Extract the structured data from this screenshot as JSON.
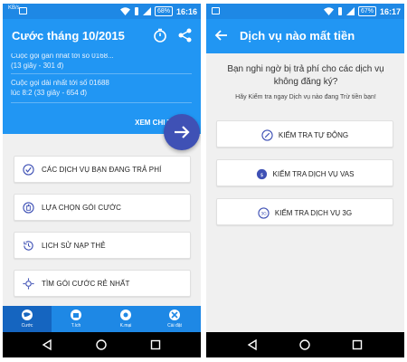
{
  "screen1": {
    "status": {
      "network": "KB/s",
      "battery": "68%",
      "time": "16:16"
    },
    "title": "Cước tháng 10/2015",
    "partial_line": "Cuộc gọi gần nhất tới số 0168...",
    "partial_line2": "(13 giây - 301 đ)",
    "longest_call_line1": "Cuộc gọi dài nhất tới số 01688",
    "longest_call_line2": "lúc 8:2 (33 giây - 654 đ)",
    "detail_link": "XEM CHI TIẾT",
    "menu": [
      {
        "label": "CÁC DỊCH VỤ BẠN ĐANG TRẢ PHÍ",
        "icon": "check-circle-icon"
      },
      {
        "label": "LỰA CHỌN GÓI CƯỚC",
        "icon": "hand-icon"
      },
      {
        "label": "LỊCH SỬ NẠP THẺ",
        "icon": "history-icon"
      },
      {
        "label": "TÌM GÓI CƯỚC RẺ NHẤT",
        "icon": "search-package-icon"
      }
    ],
    "tabs": [
      {
        "label": "Cước",
        "icon": "globe-icon",
        "active": true
      },
      {
        "label": "T.ích",
        "icon": "gift-icon",
        "active": false
      },
      {
        "label": "K.mại",
        "icon": "promo-icon",
        "active": false
      },
      {
        "label": "Cài đặt",
        "icon": "tools-icon",
        "active": false
      }
    ]
  },
  "screen2": {
    "status": {
      "battery": "67%",
      "time": "16:17"
    },
    "title": "Dịch vụ nào mất tiền",
    "question": "Bạn nghi ngờ bị trả phí cho các dịch vụ không đăng ký?",
    "hint": "Hãy Kiểm tra ngay Dịch vụ nào đang Trừ tiền bạn!",
    "buttons": [
      {
        "label": "KIỂM TRA TỰ ĐỘNG",
        "icon": "auto-check-icon"
      },
      {
        "label": "KIỂM TRA DỊCH VỤ VAS",
        "icon": "vas-icon"
      },
      {
        "label": "KIỂM TRA DỊCH VỤ 3G",
        "icon": "3g-icon"
      }
    ]
  },
  "colors": {
    "primary": "#2196f3",
    "status": "#1e88e5",
    "fab": "#3f51b5",
    "active_tab": "#1565c0"
  }
}
